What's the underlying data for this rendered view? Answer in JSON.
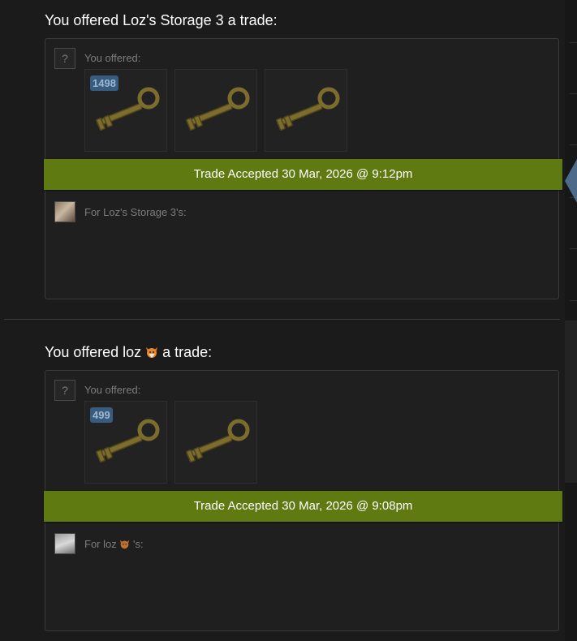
{
  "trades": [
    {
      "title": "You offered Loz's Storage 3 a trade:",
      "offer_label": "You offered:",
      "offer_items": [
        {
          "icon": "key-icon",
          "quantity": "1498"
        },
        {
          "icon": "key-icon",
          "quantity": ""
        },
        {
          "icon": "key-icon",
          "quantity": ""
        }
      ],
      "status": "Trade Accepted 30 Mar, 2026 @ 9:12pm",
      "for_label": "For Loz's Storage 3's:"
    },
    {
      "title_prefix": "You offered loz",
      "title_suffix": "a trade:",
      "offer_label": "You offered:",
      "offer_items": [
        {
          "icon": "key-icon",
          "quantity": "499"
        },
        {
          "icon": "key-icon",
          "quantity": ""
        }
      ],
      "status": "Trade Accepted 30 Mar, 2026 @ 9:08pm",
      "for_label_prefix": "For loz",
      "for_label_suffix": "'s:"
    }
  ],
  "icons": {
    "unknown_avatar": "?"
  },
  "colors": {
    "status_bar": "#5e7a10",
    "quantity_badge": "#375c80",
    "background": "#1b1b1b"
  }
}
